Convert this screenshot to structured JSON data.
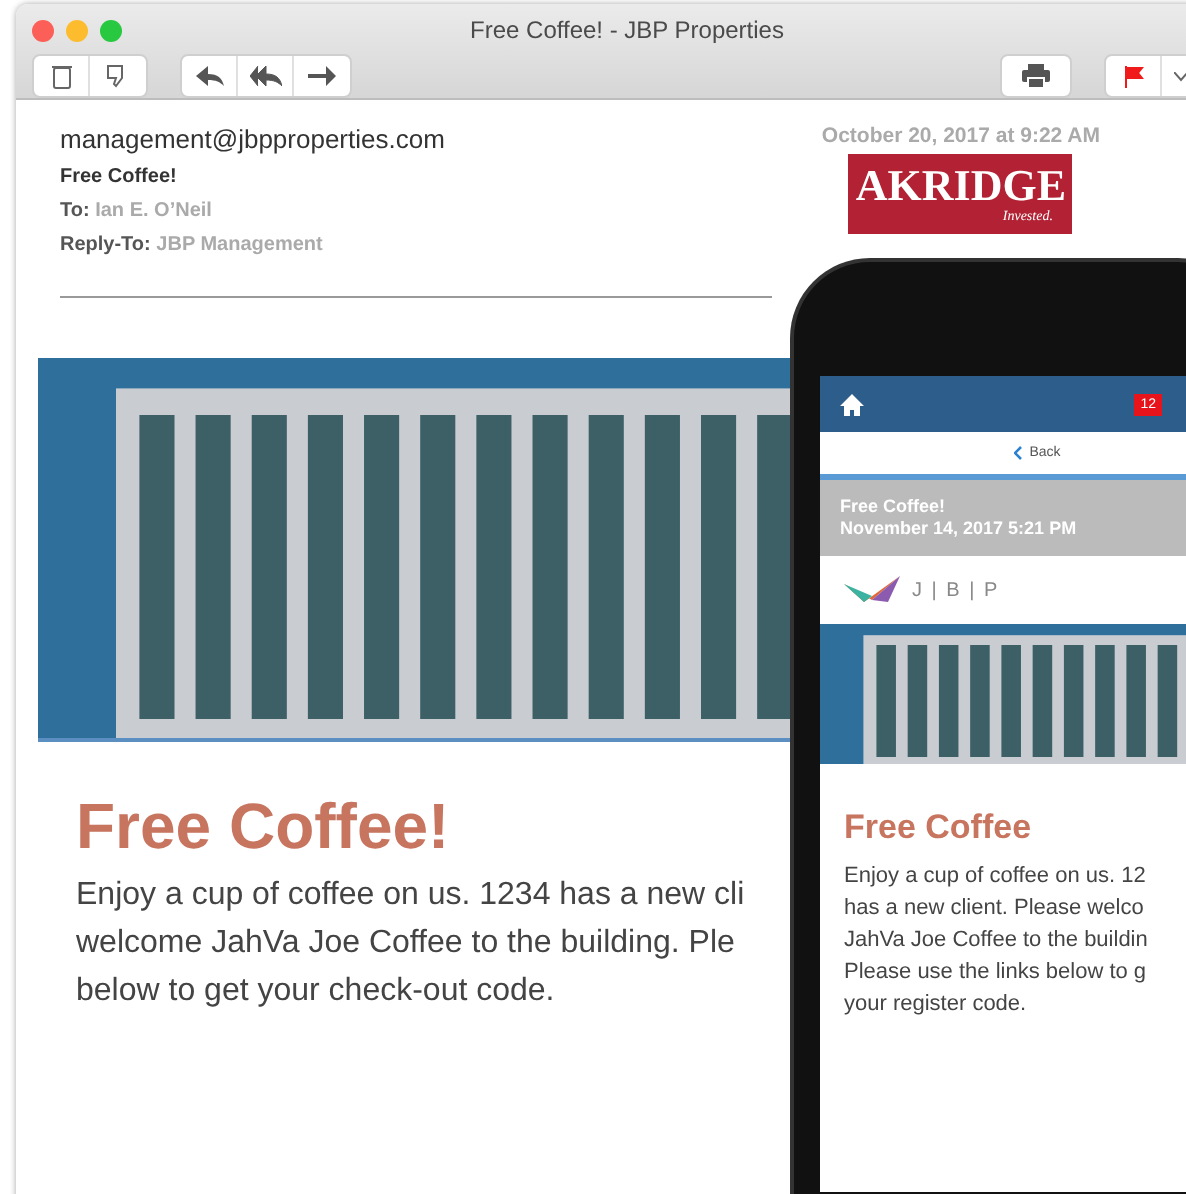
{
  "window": {
    "title": "Free Coffee! - JBP Properties"
  },
  "email": {
    "from": "management@jbpproperties.com",
    "subject": "Free Coffee!",
    "to_label": "To:",
    "to": "Ian E. O’Neil",
    "reply_to_label": "Reply-To:",
    "reply_to": "JBP Management",
    "date": "October 20, 2017 at 9:22 AM",
    "logo_text": "AKRIDGE",
    "logo_tagline": "Invested.",
    "headline": "Free Coffee!",
    "body_lines": [
      "Enjoy a cup of coffee on us. 1234 has a new cli",
      "welcome JahVa Joe Coffee to the building. Ple",
      "below to get your check-out code."
    ]
  },
  "phone": {
    "badge": "12",
    "back": "Back",
    "subject": "Free Coffee!",
    "date": "November 14, 2017 5:21 PM",
    "logo_letters": "J | B | P",
    "headline": "Free Coffee",
    "body_lines": [
      "Enjoy a cup of coffee on us. 12",
      "has a new client. Please welco",
      "JahVa Joe Coffee to the buildin",
      "Please use the links below to g",
      "your register code."
    ]
  }
}
